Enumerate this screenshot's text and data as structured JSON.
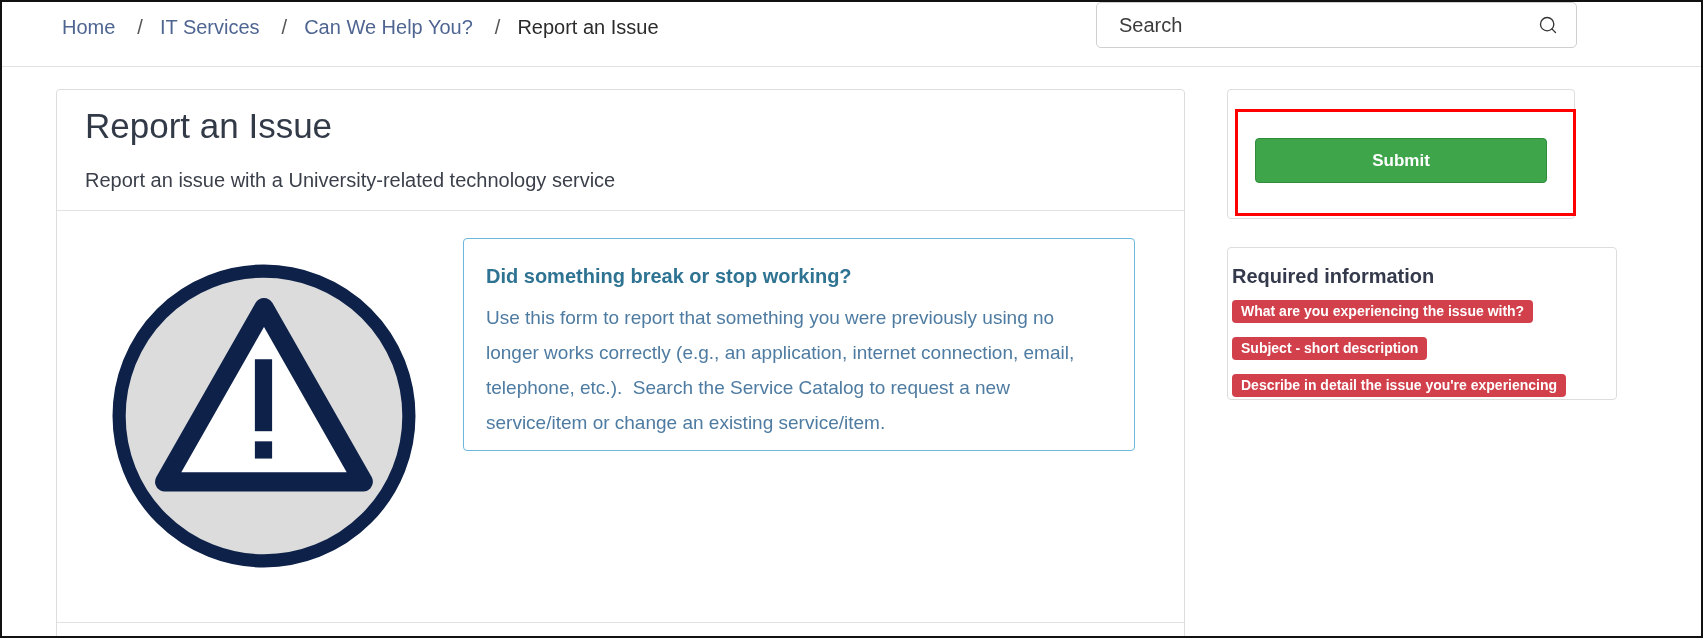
{
  "breadcrumb": [
    {
      "label": "Home",
      "current": false
    },
    {
      "separator": "/",
      "label": "IT Services",
      "current": false
    },
    {
      "separator": "/",
      "label": "Can We Help You?",
      "current": false
    },
    {
      "separator": "/",
      "label": "Report an Issue",
      "current": true
    }
  ],
  "search": {
    "placeholder": "Search"
  },
  "card": {
    "title": "Report an Issue",
    "subtitle": "Report an issue with a University-related technology service"
  },
  "notice": {
    "title": "Did something break or stop working?",
    "text": "Use this form to report that something you were previously using no longer works correctly (e.g., an application, internet connection, email, telephone, etc.).  Search the Service Catalog to request a new service/item or change an existing service/item."
  },
  "submit": {
    "label": "Submit",
    "highlighted": true
  },
  "required_information": {
    "title": "Required information",
    "items": [
      "What are you experiencing the issue with?",
      "Subject - short description",
      "Describe in detail the issue you're experiencing"
    ]
  }
}
